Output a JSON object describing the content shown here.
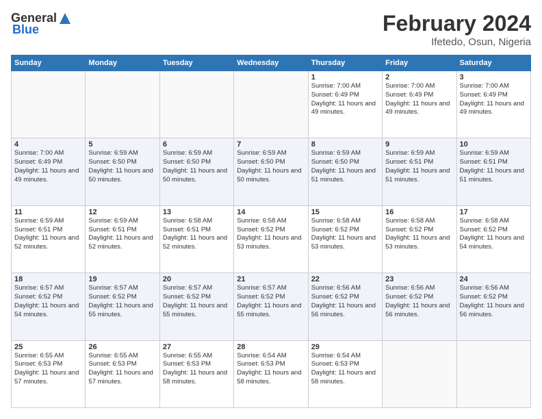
{
  "logo": {
    "general": "General",
    "blue": "Blue"
  },
  "title": "February 2024",
  "location": "Ifetedo, Osun, Nigeria",
  "weekdays": [
    "Sunday",
    "Monday",
    "Tuesday",
    "Wednesday",
    "Thursday",
    "Friday",
    "Saturday"
  ],
  "weeks": [
    [
      {
        "day": "",
        "sunrise": "",
        "sunset": "",
        "daylight": ""
      },
      {
        "day": "",
        "sunrise": "",
        "sunset": "",
        "daylight": ""
      },
      {
        "day": "",
        "sunrise": "",
        "sunset": "",
        "daylight": ""
      },
      {
        "day": "",
        "sunrise": "",
        "sunset": "",
        "daylight": ""
      },
      {
        "day": "1",
        "sunrise": "Sunrise: 7:00 AM",
        "sunset": "Sunset: 6:49 PM",
        "daylight": "Daylight: 11 hours and 49 minutes."
      },
      {
        "day": "2",
        "sunrise": "Sunrise: 7:00 AM",
        "sunset": "Sunset: 6:49 PM",
        "daylight": "Daylight: 11 hours and 49 minutes."
      },
      {
        "day": "3",
        "sunrise": "Sunrise: 7:00 AM",
        "sunset": "Sunset: 6:49 PM",
        "daylight": "Daylight: 11 hours and 49 minutes."
      }
    ],
    [
      {
        "day": "4",
        "sunrise": "Sunrise: 7:00 AM",
        "sunset": "Sunset: 6:49 PM",
        "daylight": "Daylight: 11 hours and 49 minutes."
      },
      {
        "day": "5",
        "sunrise": "Sunrise: 6:59 AM",
        "sunset": "Sunset: 6:50 PM",
        "daylight": "Daylight: 11 hours and 50 minutes."
      },
      {
        "day": "6",
        "sunrise": "Sunrise: 6:59 AM",
        "sunset": "Sunset: 6:50 PM",
        "daylight": "Daylight: 11 hours and 50 minutes."
      },
      {
        "day": "7",
        "sunrise": "Sunrise: 6:59 AM",
        "sunset": "Sunset: 6:50 PM",
        "daylight": "Daylight: 11 hours and 50 minutes."
      },
      {
        "day": "8",
        "sunrise": "Sunrise: 6:59 AM",
        "sunset": "Sunset: 6:50 PM",
        "daylight": "Daylight: 11 hours and 51 minutes."
      },
      {
        "day": "9",
        "sunrise": "Sunrise: 6:59 AM",
        "sunset": "Sunset: 6:51 PM",
        "daylight": "Daylight: 11 hours and 51 minutes."
      },
      {
        "day": "10",
        "sunrise": "Sunrise: 6:59 AM",
        "sunset": "Sunset: 6:51 PM",
        "daylight": "Daylight: 11 hours and 51 minutes."
      }
    ],
    [
      {
        "day": "11",
        "sunrise": "Sunrise: 6:59 AM",
        "sunset": "Sunset: 6:51 PM",
        "daylight": "Daylight: 11 hours and 52 minutes."
      },
      {
        "day": "12",
        "sunrise": "Sunrise: 6:59 AM",
        "sunset": "Sunset: 6:51 PM",
        "daylight": "Daylight: 11 hours and 52 minutes."
      },
      {
        "day": "13",
        "sunrise": "Sunrise: 6:58 AM",
        "sunset": "Sunset: 6:51 PM",
        "daylight": "Daylight: 11 hours and 52 minutes."
      },
      {
        "day": "14",
        "sunrise": "Sunrise: 6:58 AM",
        "sunset": "Sunset: 6:52 PM",
        "daylight": "Daylight: 11 hours and 53 minutes."
      },
      {
        "day": "15",
        "sunrise": "Sunrise: 6:58 AM",
        "sunset": "Sunset: 6:52 PM",
        "daylight": "Daylight: 11 hours and 53 minutes."
      },
      {
        "day": "16",
        "sunrise": "Sunrise: 6:58 AM",
        "sunset": "Sunset: 6:52 PM",
        "daylight": "Daylight: 11 hours and 53 minutes."
      },
      {
        "day": "17",
        "sunrise": "Sunrise: 6:58 AM",
        "sunset": "Sunset: 6:52 PM",
        "daylight": "Daylight: 11 hours and 54 minutes."
      }
    ],
    [
      {
        "day": "18",
        "sunrise": "Sunrise: 6:57 AM",
        "sunset": "Sunset: 6:52 PM",
        "daylight": "Daylight: 11 hours and 54 minutes."
      },
      {
        "day": "19",
        "sunrise": "Sunrise: 6:57 AM",
        "sunset": "Sunset: 6:52 PM",
        "daylight": "Daylight: 11 hours and 55 minutes."
      },
      {
        "day": "20",
        "sunrise": "Sunrise: 6:57 AM",
        "sunset": "Sunset: 6:52 PM",
        "daylight": "Daylight: 11 hours and 55 minutes."
      },
      {
        "day": "21",
        "sunrise": "Sunrise: 6:57 AM",
        "sunset": "Sunset: 6:52 PM",
        "daylight": "Daylight: 11 hours and 55 minutes."
      },
      {
        "day": "22",
        "sunrise": "Sunrise: 6:56 AM",
        "sunset": "Sunset: 6:52 PM",
        "daylight": "Daylight: 11 hours and 56 minutes."
      },
      {
        "day": "23",
        "sunrise": "Sunrise: 6:56 AM",
        "sunset": "Sunset: 6:52 PM",
        "daylight": "Daylight: 11 hours and 56 minutes."
      },
      {
        "day": "24",
        "sunrise": "Sunrise: 6:56 AM",
        "sunset": "Sunset: 6:52 PM",
        "daylight": "Daylight: 11 hours and 56 minutes."
      }
    ],
    [
      {
        "day": "25",
        "sunrise": "Sunrise: 6:55 AM",
        "sunset": "Sunset: 6:53 PM",
        "daylight": "Daylight: 11 hours and 57 minutes."
      },
      {
        "day": "26",
        "sunrise": "Sunrise: 6:55 AM",
        "sunset": "Sunset: 6:53 PM",
        "daylight": "Daylight: 11 hours and 57 minutes."
      },
      {
        "day": "27",
        "sunrise": "Sunrise: 6:55 AM",
        "sunset": "Sunset: 6:53 PM",
        "daylight": "Daylight: 11 hours and 58 minutes."
      },
      {
        "day": "28",
        "sunrise": "Sunrise: 6:54 AM",
        "sunset": "Sunset: 6:53 PM",
        "daylight": "Daylight: 11 hours and 58 minutes."
      },
      {
        "day": "29",
        "sunrise": "Sunrise: 6:54 AM",
        "sunset": "Sunset: 6:53 PM",
        "daylight": "Daylight: 11 hours and 58 minutes."
      },
      {
        "day": "",
        "sunrise": "",
        "sunset": "",
        "daylight": ""
      },
      {
        "day": "",
        "sunrise": "",
        "sunset": "",
        "daylight": ""
      }
    ]
  ]
}
